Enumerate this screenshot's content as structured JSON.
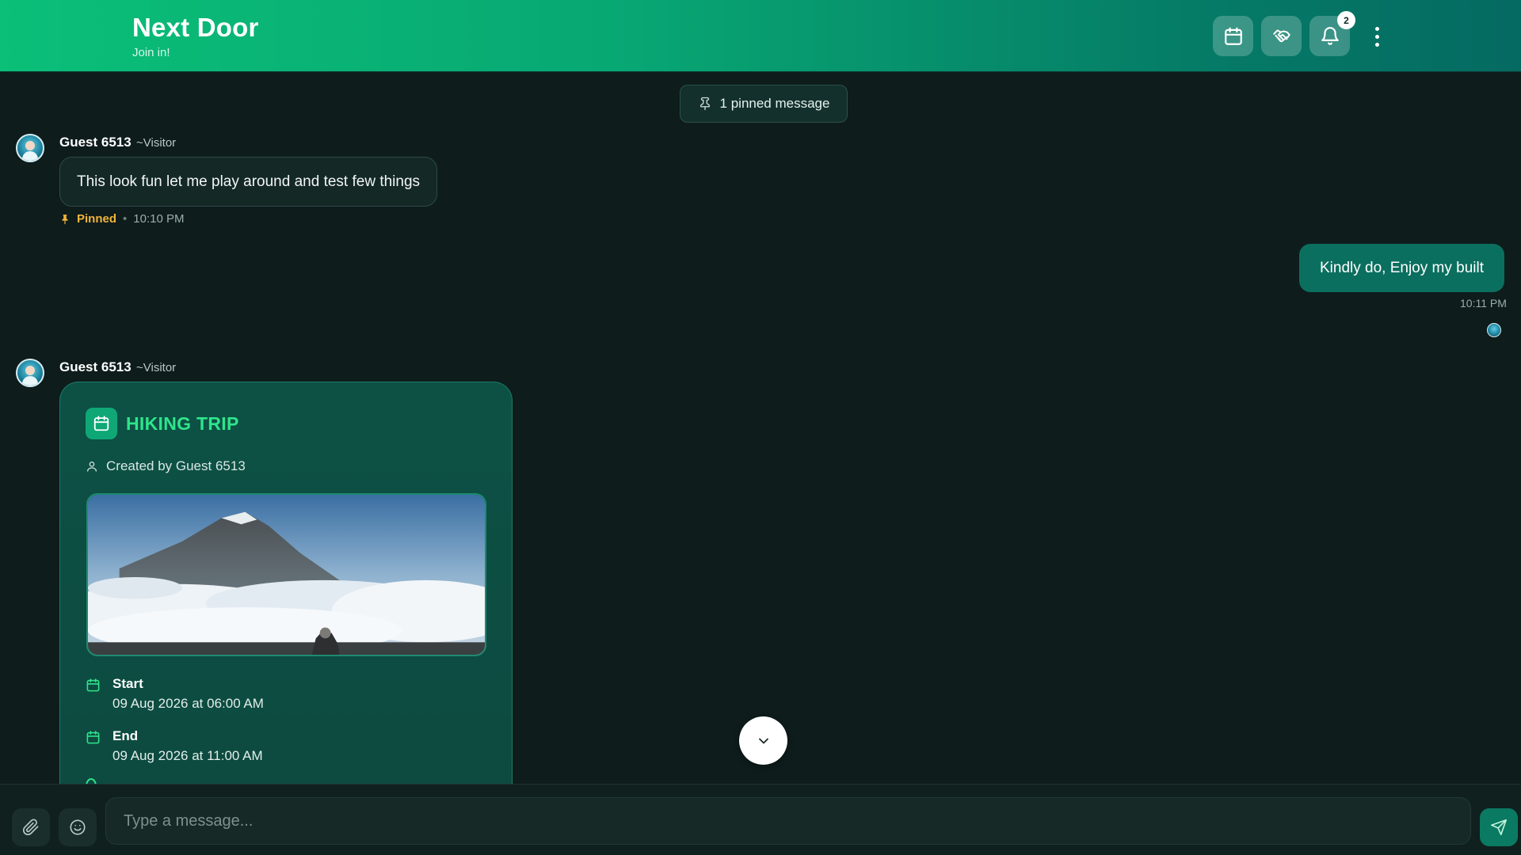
{
  "header": {
    "title": "Next Door",
    "subtitle": "Join in!",
    "calendar_icon": "calendar-icon",
    "handshake_icon": "handshake-icon",
    "bell_icon": "bell-icon",
    "notification_count": "2",
    "more_icon": "more-vertical-icon"
  },
  "pinned_banner": {
    "label": "1 pinned message",
    "icon": "pin-icon"
  },
  "messages": [
    {
      "sender": "Guest 6513",
      "role": "~Visitor",
      "text": "This look fun let me play around and test few things",
      "pinned_label": "Pinned",
      "time": "10:10 PM"
    },
    {
      "text": "Kindly do, Enjoy my built",
      "time": "10:11 PM"
    },
    {
      "sender": "Guest 6513",
      "role": "~Visitor",
      "event": {
        "title": "HIKING TRIP",
        "created_by": "Created by Guest 6513",
        "start_label": "Start",
        "start_value": "09 Aug 2026 at 06:00 AM",
        "end_label": "End",
        "end_value": "09 Aug 2026 at 11:00 AM"
      }
    }
  ],
  "composer": {
    "placeholder": "Type a message...",
    "attach_icon": "paperclip-icon",
    "emoji_icon": "smile-icon",
    "send_icon": "send-icon"
  },
  "colors": {
    "header_start": "#0bbf78",
    "header_end": "#056a62",
    "background": "#0e1c1c",
    "accent": "#2ee58b",
    "pinned": "#f2b53a",
    "outgoing_bubble": "#0b6f5f"
  }
}
